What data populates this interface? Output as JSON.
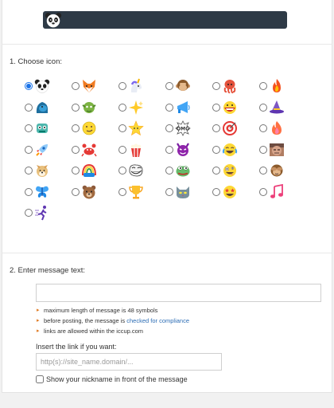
{
  "section1": {
    "title": "1. Choose icon:"
  },
  "section2": {
    "title": "2. Enter message text:"
  },
  "message": {
    "value": "",
    "placeholder": ""
  },
  "notes": {
    "max_length": "maximum length of message is 48 symbols",
    "compliance_prefix": "before posting, the message is ",
    "compliance_link": "checked for compliance",
    "links_allowed": "links are allowed within the iccup.com"
  },
  "link": {
    "label": "Insert the link if you want:",
    "placeholder": "http(s)://site_name.domain/..."
  },
  "nickname": {
    "label": "Show your nickname in front of the message",
    "checked": false
  },
  "selected_icon": "panda-icon",
  "icons": [
    "panda-icon",
    "fox-icon",
    "unicorn-icon",
    "monkey-icon",
    "octopus-icon",
    "fire-icon",
    "gorilla-icon",
    "goblin-icon",
    "sparkle-icon",
    "megaphone-icon",
    "chomp-icon",
    "witch-hat-icon",
    "robot-icon",
    "smirk-icon",
    "star-face-icon",
    "omg-icon",
    "target-icon",
    "flame-icon",
    "rocket-icon",
    "crab-icon",
    "popcorn-icon",
    "devil-icon",
    "laughing-cry-icon",
    "face-photo-icon",
    "doge-icon",
    "rainbow-icon",
    "troll-icon",
    "pepe-icon",
    "crazy-face-icon",
    "see-no-evil-icon",
    "butterfly-icon",
    "bear-icon",
    "trophy-icon",
    "cat-icon",
    "star-eyes-icon",
    "music-icon",
    "runner-icon"
  ]
}
